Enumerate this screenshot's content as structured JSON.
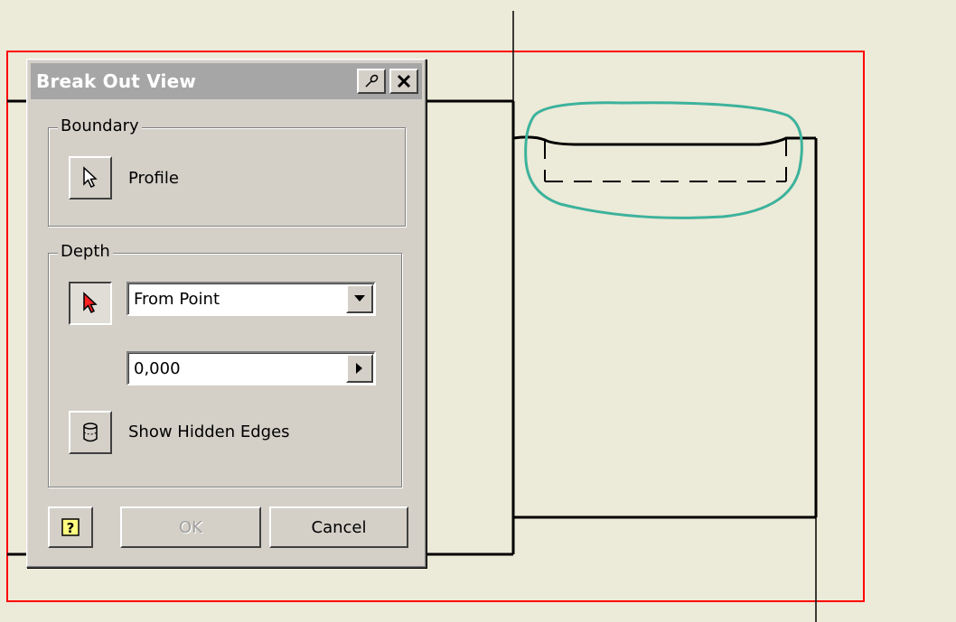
{
  "dialog": {
    "title": "Break Out View",
    "pin_icon": "pin-icon",
    "close_icon": "close-icon",
    "boundary": {
      "group_label": "Boundary",
      "profile_label": "Profile",
      "icon": "arrow-cursor-icon"
    },
    "depth": {
      "group_label": "Depth",
      "icon": "red-arrow-cursor-icon",
      "mode_value": "From Point",
      "distance_value": "0,000",
      "hidden_edges_label": "Show Hidden Edges",
      "hidden_edges_icon": "cylinder-icon"
    },
    "buttons": {
      "help_icon": "help-icon",
      "ok_label": "OK",
      "cancel_label": "Cancel"
    }
  },
  "colors": {
    "canvas": "#ecead8",
    "sheet_border": "#ff0000",
    "highlight": "#3cb29c",
    "dialog_bg": "#d4d0c8",
    "titlebar_inactive": "#a6a6a6"
  }
}
